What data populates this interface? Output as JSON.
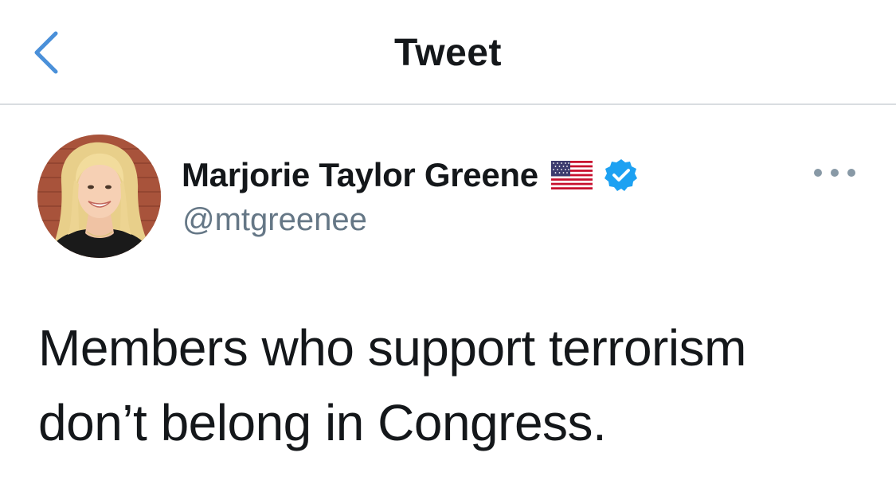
{
  "nav": {
    "back_icon": "chevron-left-icon",
    "title": "Tweet"
  },
  "tweet": {
    "author": {
      "display_name": "Marjorie Taylor Greene",
      "handle": "@mtgreenee",
      "badges": [
        "us-flag-icon",
        "verified-badge-icon"
      ]
    },
    "more_icon": "more-horizontal-icon",
    "text": "Members who support terrorism\ndon’t belong in Congress."
  },
  "colors": {
    "accent_blue": "#1da1f2",
    "back_chevron": "#4a90d9",
    "handle_gray": "#657786",
    "text_primary": "#14171a",
    "divider": "#d9dde1"
  }
}
